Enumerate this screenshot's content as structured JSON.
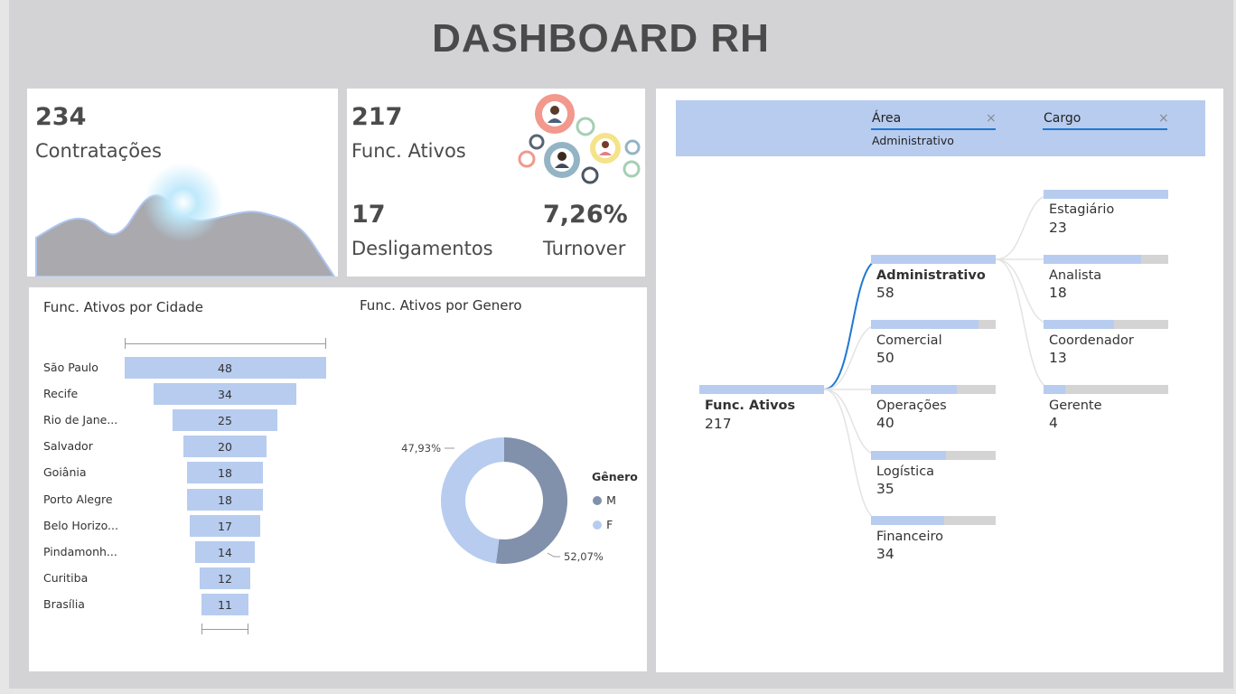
{
  "title": "DASHBOARD RH",
  "kpis": {
    "hires": {
      "value": "234",
      "label": "Contratações"
    },
    "active": {
      "value": "217",
      "label": "Func. Ativos"
    },
    "layoffs": {
      "value": "17",
      "label": "Desligamentos"
    },
    "turnover": {
      "value": "7,26%",
      "label": "Turnover"
    }
  },
  "funnel": {
    "title": "Func. Ativos por Cidade",
    "rows": [
      {
        "city": "São Paulo",
        "value": "48"
      },
      {
        "city": "Recife",
        "value": "34"
      },
      {
        "city": "Rio de Jane...",
        "value": "25"
      },
      {
        "city": "Salvador",
        "value": "20"
      },
      {
        "city": "Goiânia",
        "value": "18"
      },
      {
        "city": "Porto Alegre",
        "value": "18"
      },
      {
        "city": "Belo Horizo...",
        "value": "17"
      },
      {
        "city": "Pindamonh...",
        "value": "14"
      },
      {
        "city": "Curitiba",
        "value": "12"
      },
      {
        "city": "Brasília",
        "value": "11"
      }
    ]
  },
  "donut": {
    "title": "Func. Ativos por Genero",
    "legend_title": "Gênero",
    "legend": [
      {
        "label": "M",
        "color": "#8190ab"
      },
      {
        "label": "F",
        "color": "#b7ccef"
      }
    ],
    "label_f": "47,93%",
    "label_m": "52,07%"
  },
  "chart_data": {
    "type": "pie",
    "title": "Func. Ativos por Genero",
    "categories": [
      "M",
      "F"
    ],
    "values": [
      52.07,
      47.93
    ]
  },
  "tree": {
    "filters": [
      {
        "label": "Área",
        "value": "Administrativo",
        "close": "×"
      },
      {
        "label": "Cargo",
        "value": "",
        "close": "×"
      }
    ],
    "root": {
      "name": "Func. Ativos",
      "value": "217",
      "fill": 1.0
    },
    "areas": [
      {
        "name": "Administrativo",
        "value": "58",
        "fill": 1.0,
        "selected": true
      },
      {
        "name": "Comercial",
        "value": "50",
        "fill": 0.862
      },
      {
        "name": "Operações",
        "value": "40",
        "fill": 0.69
      },
      {
        "name": "Logística",
        "value": "35",
        "fill": 0.603
      },
      {
        "name": "Financeiro",
        "value": "34",
        "fill": 0.586
      }
    ],
    "roles": [
      {
        "name": "Estagiário",
        "value": "23",
        "fill": 1.0
      },
      {
        "name": "Analista",
        "value": "18",
        "fill": 0.783
      },
      {
        "name": "Coordenador",
        "value": "13",
        "fill": 0.565
      },
      {
        "name": "Gerente",
        "value": "4",
        "fill": 0.174
      }
    ]
  }
}
